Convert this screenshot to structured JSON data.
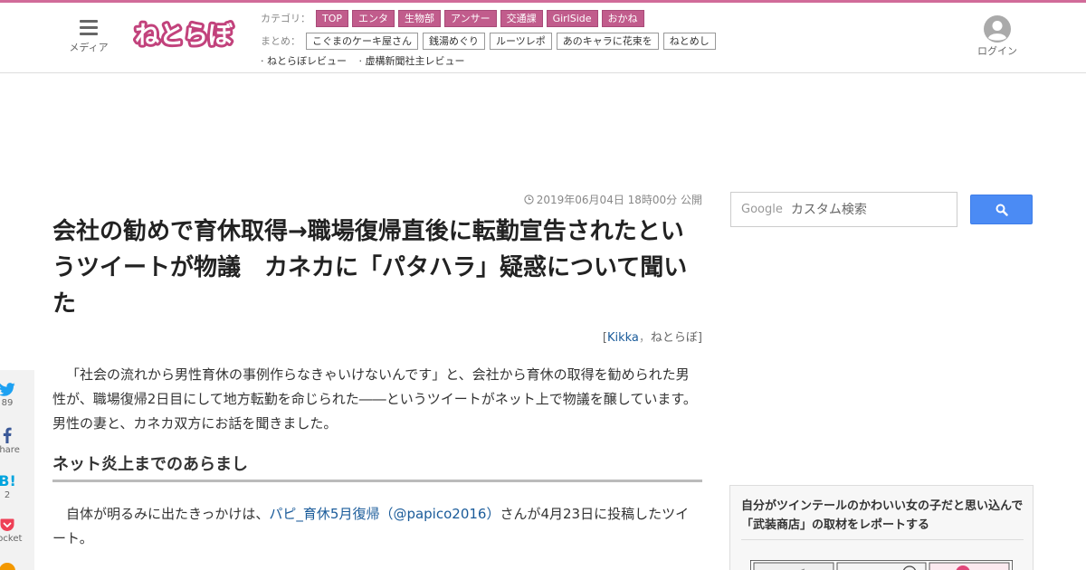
{
  "header": {
    "menu_label": "メディア",
    "logo_text": "ねとらぼ",
    "category_label": "カテゴリ：",
    "categories": [
      "TOP",
      "エンタ",
      "生物部",
      "アンサー",
      "交通課",
      "GirlSide",
      "おかね"
    ],
    "summary_label": "まとめ：",
    "summaries": [
      "こぐまのケーキ屋さん",
      "銭湯めぐり",
      "ルーツレポ",
      "あのキャラに花束を",
      "ねとめし"
    ],
    "links": [
      "· ねとらぼレビュー",
      "· 虚構新聞社主レビュー"
    ],
    "login_label": "ログイン",
    "colors": {
      "accent": "#d16b99",
      "category_bg": "#c15c8c"
    }
  },
  "article": {
    "date": "2019年06月04日 18時00分 公開",
    "title": "会社の勧めで育休取得→職場復帰直後に転勤宣告されたというツイートが物議　カネカに「パタハラ」疑惑について聞いた",
    "byline_open": "[",
    "author": "Kikka",
    "byline_sep": "，",
    "publisher": "ねとらぼ",
    "byline_close": "]",
    "lead": "「社会の流れから男性育休の事例作らなきゃいけないんです」と、会社から育休の取得を勧められた男性が、職場復帰2日目にして地方転勤を命じられた――というツイートがネット上で物議を醸しています。男性の妻と、カネカ双方にお話を聞きました。",
    "heading": "ネット炎上までのあらまし",
    "para2_before": "自体が明るみに出たきっかけは、",
    "para2_link": "パピ_育休5月復帰（@papico2016）",
    "para2_after": "さんが4月23日に投稿したツイート。"
  },
  "share": {
    "twitter_count": "89",
    "facebook_label": "share",
    "hatena_count": "2",
    "pocket_label": "Pocket"
  },
  "sidebar": {
    "search_brand": "Google",
    "search_placeholder": "カスタム検索",
    "promo_title": "自分がツインテールのかわいい女の子だと思い込んで「武装商店」の取材をレポートする"
  }
}
